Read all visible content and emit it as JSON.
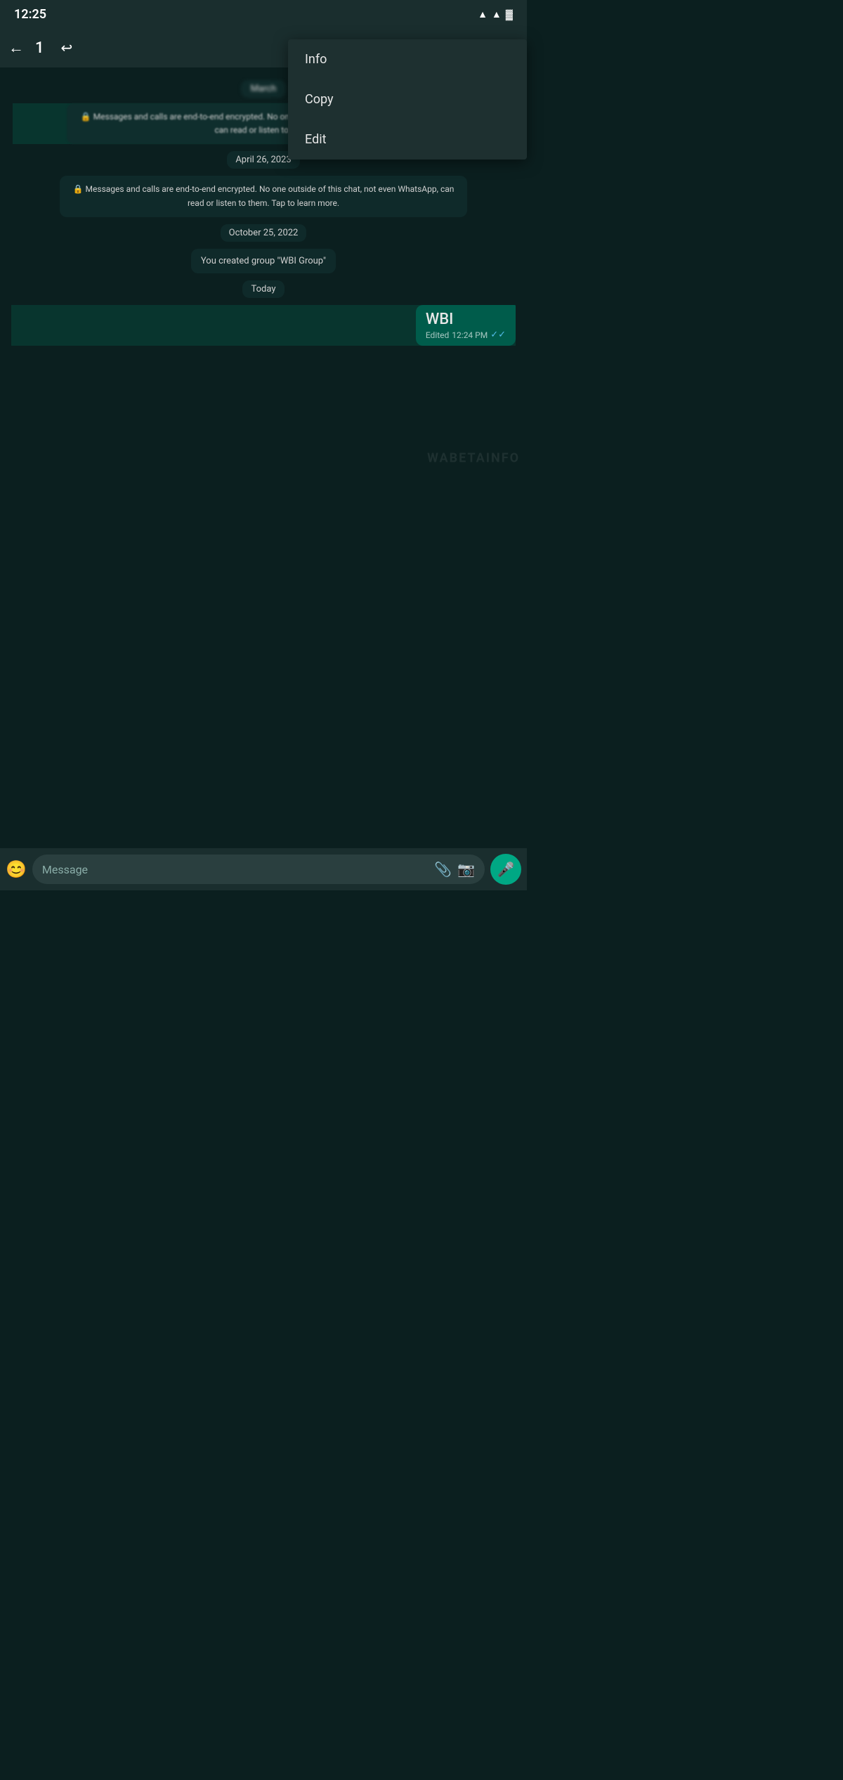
{
  "status": {
    "time": "12:25",
    "wifi_icon": "▲",
    "signal_icon": "▲",
    "battery_icon": "▓"
  },
  "topBar": {
    "back_icon": "←",
    "selected_count": "1",
    "reply_icon": "↩",
    "menu_visible": true
  },
  "contextMenu": {
    "items": [
      {
        "id": "info",
        "label": "Info"
      },
      {
        "id": "copy",
        "label": "Copy"
      },
      {
        "id": "edit",
        "label": "Edit"
      }
    ]
  },
  "chat": {
    "watermark": "WABETAINFO",
    "dates": {
      "march": "March",
      "april26": "April 26, 2023",
      "oct25": "October 25, 2022",
      "today": "Today"
    },
    "encryption_notices": [
      {
        "id": "enc1",
        "text": "🔒 Messages and calls are end-to-end encrypted. No one outside of this chat, not even WhatsApp, can read or listen to them."
      },
      {
        "id": "enc2",
        "text": "🔒 Messages and calls are end-to-end encrypted. No one outside of this chat, not even WhatsApp, can read or listen to them. Tap to learn more."
      }
    ],
    "system_messages": [
      {
        "id": "sys1",
        "text": "You created group \"WBI Group\""
      }
    ],
    "messages": [
      {
        "id": "msg1",
        "text": "WBI",
        "edited_label": "Edited",
        "time": "12:24 PM",
        "status": "read"
      }
    ]
  },
  "inputBar": {
    "placeholder": "Message",
    "emoji_icon": "😊",
    "attach_icon": "📎",
    "camera_icon": "📷",
    "mic_icon": "🎤"
  }
}
